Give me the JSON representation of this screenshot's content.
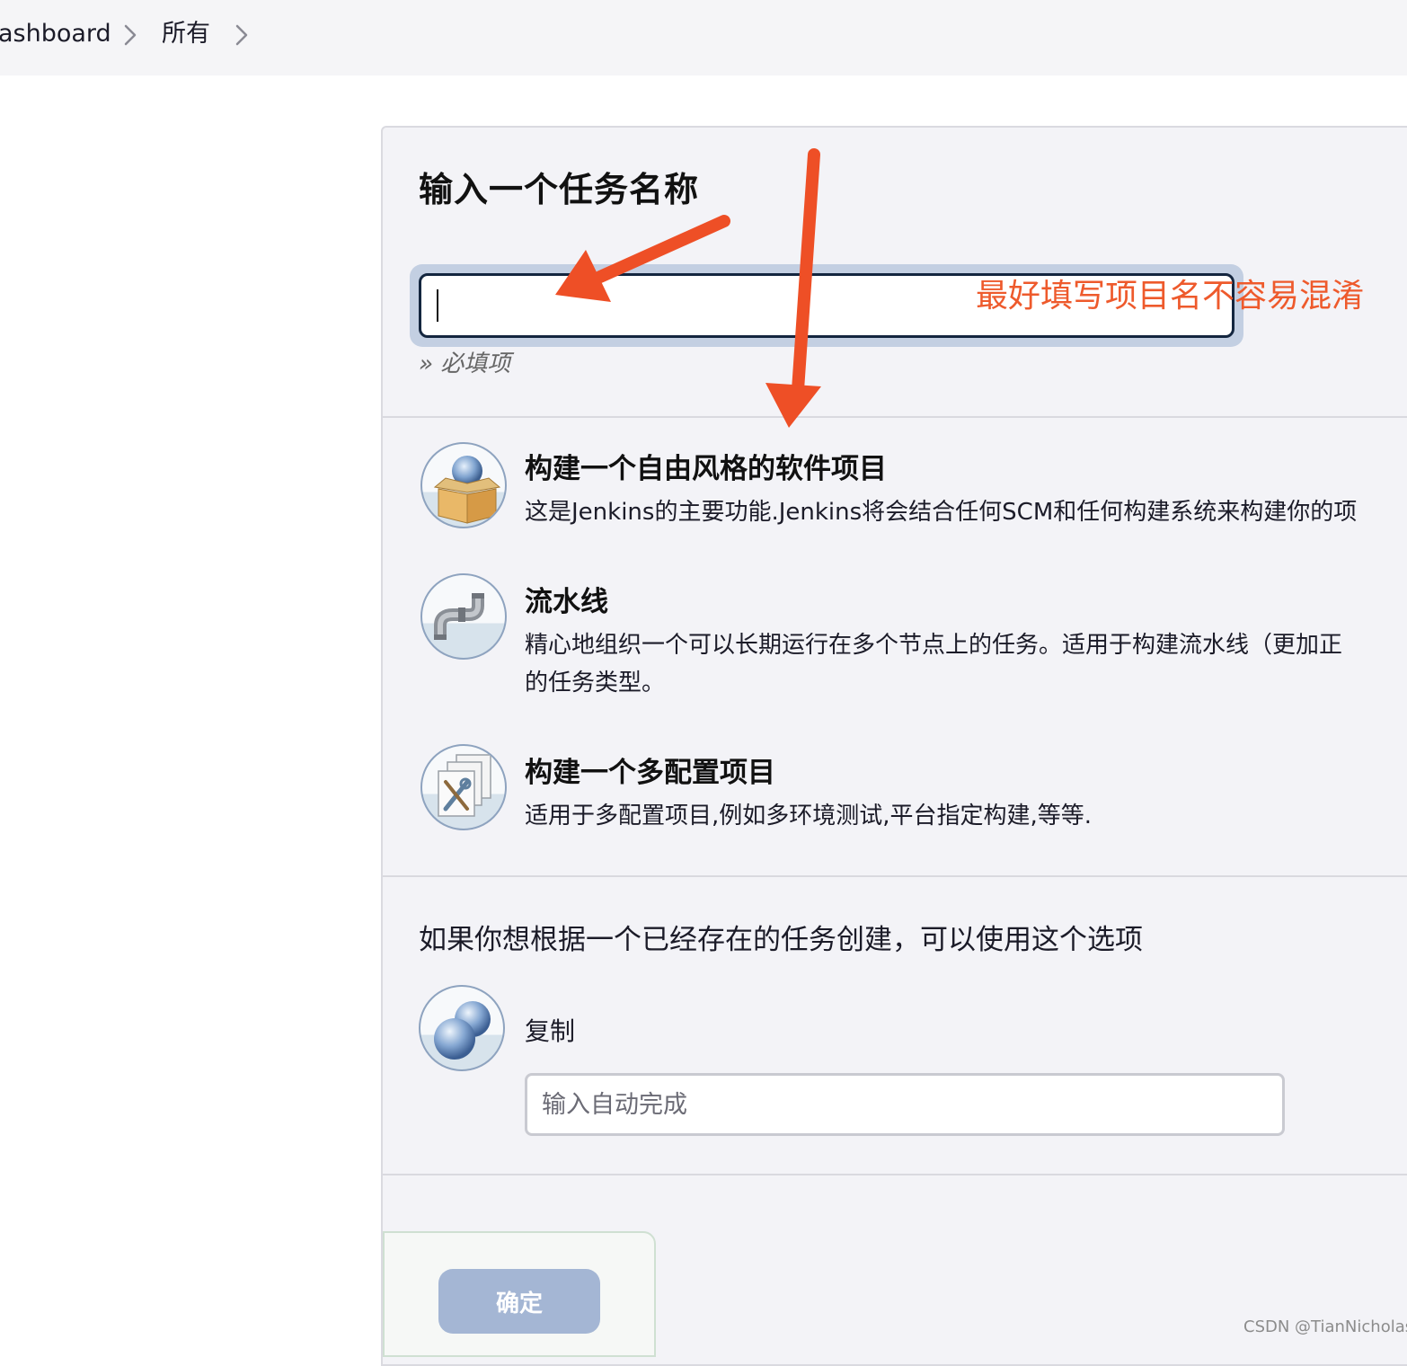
{
  "breadcrumb": {
    "items": [
      {
        "label": "ashboard"
      },
      {
        "label": "所有"
      }
    ]
  },
  "form": {
    "title": "输入一个任务名称",
    "name_input": {
      "value": ""
    },
    "required_hint": "» 必填项"
  },
  "item_types": [
    {
      "title": "构建一个自由风格的软件项目",
      "description": [
        "这是Jenkins的主要功能.Jenkins将会结合任何SCM和任何构建系统来构建你的项"
      ],
      "icon": "freestyle-box-icon"
    },
    {
      "title": "流水线",
      "description": [
        "精心地组织一个可以长期运行在多个节点上的任务。适用于构建流水线（更加正",
        "的任务类型。"
      ],
      "icon": "pipeline-pipe-icon"
    },
    {
      "title": "构建一个多配置项目",
      "description": [
        "适用于多配置项目,例如多环境测试,平台指定构建,等等."
      ],
      "icon": "multiconfig-tools-icon"
    }
  ],
  "copy_section": {
    "heading": "如果你想根据一个已经存在的任务创建，可以使用这个选项",
    "label": "复制",
    "input_placeholder": "输入自动完成",
    "icon": "copy-spheres-icon"
  },
  "actions": {
    "ok_label": "确定"
  },
  "annotation": {
    "text": "最好填写项目名不容易混淆",
    "color": "#ee5a2c"
  },
  "watermark": "CSDN @TianNicholas"
}
